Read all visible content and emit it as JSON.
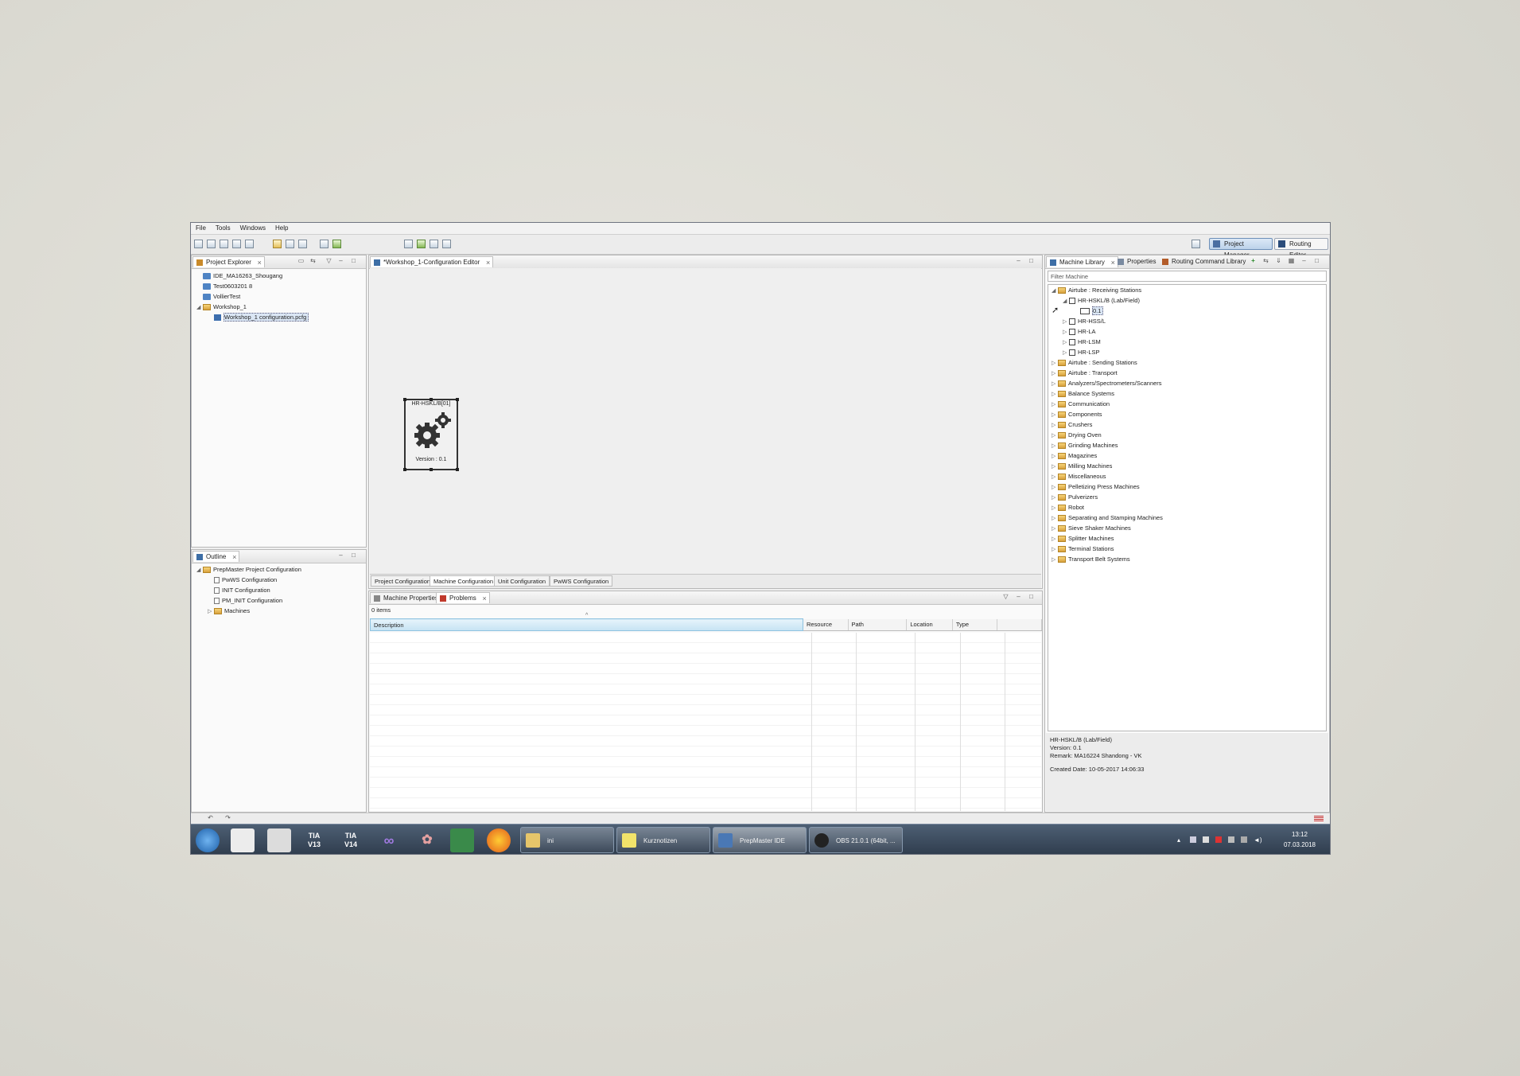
{
  "menu": [
    "File",
    "Tools",
    "Windows",
    "Help"
  ],
  "perspectives": {
    "project_manager": "Project Manager",
    "routing_editor": "Routing Editor"
  },
  "project_explorer": {
    "tab": "Project Explorer",
    "items": [
      {
        "label": "IDE_MA16263_Shougang"
      },
      {
        "label": "Test0603201 8"
      },
      {
        "label": "VollierTest"
      },
      {
        "label": "Workshop_1"
      },
      {
        "label": "Workshop_1 configuration.pcfg"
      }
    ]
  },
  "outline": {
    "tab": "Outline",
    "root": "PrepMaster Project Configuration",
    "children": [
      "PwWS Configuration",
      "INIT Configuration",
      "PM_INIT Configuration",
      "Machines"
    ]
  },
  "editor": {
    "tab": "*Workshop_1-Configuration Editor",
    "node_title": "HR-HSKL/B[01]",
    "node_version": "Version : 0.1",
    "bottom_tabs": [
      "Project Configuration",
      "Machine Configuration",
      "Unit Configuration",
      "PwWS Configuration"
    ]
  },
  "problems": {
    "tabs": [
      "Machine Properties",
      "Problems"
    ],
    "count": "0 items",
    "columns": [
      "Description",
      "Resource",
      "Path",
      "Location",
      "Type"
    ]
  },
  "library": {
    "tabs": [
      "Machine Library",
      "Properties",
      "Routing Command Library"
    ],
    "filter_placeholder": "Filter Machine",
    "tree": {
      "receiving": "Airtube : Receiving Stations",
      "machine": "HR-HSKL/B (Lab/Field)",
      "version": "0.1",
      "siblings": [
        "HR-HSS/L",
        "HR-LA",
        "HR-LSM",
        "HR-LSP"
      ],
      "categories": [
        "Airtube : Sending Stations",
        "Airtube : Transport",
        "Analyzers/Spectrometers/Scanners",
        "Balance Systems",
        "Communication",
        "Components",
        "Crushers",
        "Drying Oven",
        "Grinding Machines",
        "Magazines",
        "Milling Machines",
        "Miscellaneous",
        "Pelletizing Press Machines",
        "Pulverizers",
        "Robot",
        "Separating and Stamping Machines",
        "Sieve Shaker Machines",
        "Splitter Machines",
        "Terminal Stations",
        "Transport Belt Systems"
      ]
    },
    "info": {
      "name": "HR-HSKL/B (Lab/Field)",
      "version": "Version: 0.1",
      "remark": "Remark: MA16224 Shandong - VK",
      "created": "Created Date: 10-05-2017 14:06:33"
    }
  },
  "taskbar": {
    "tia13": "TIA V13",
    "tia14": "TIA V14",
    "apps": [
      "ini",
      "Kurznotizen",
      "PrepMaster IDE",
      "OBS 21.0.1 (64bit, ..."
    ],
    "time": "13:12",
    "date": "07.03.2018"
  }
}
